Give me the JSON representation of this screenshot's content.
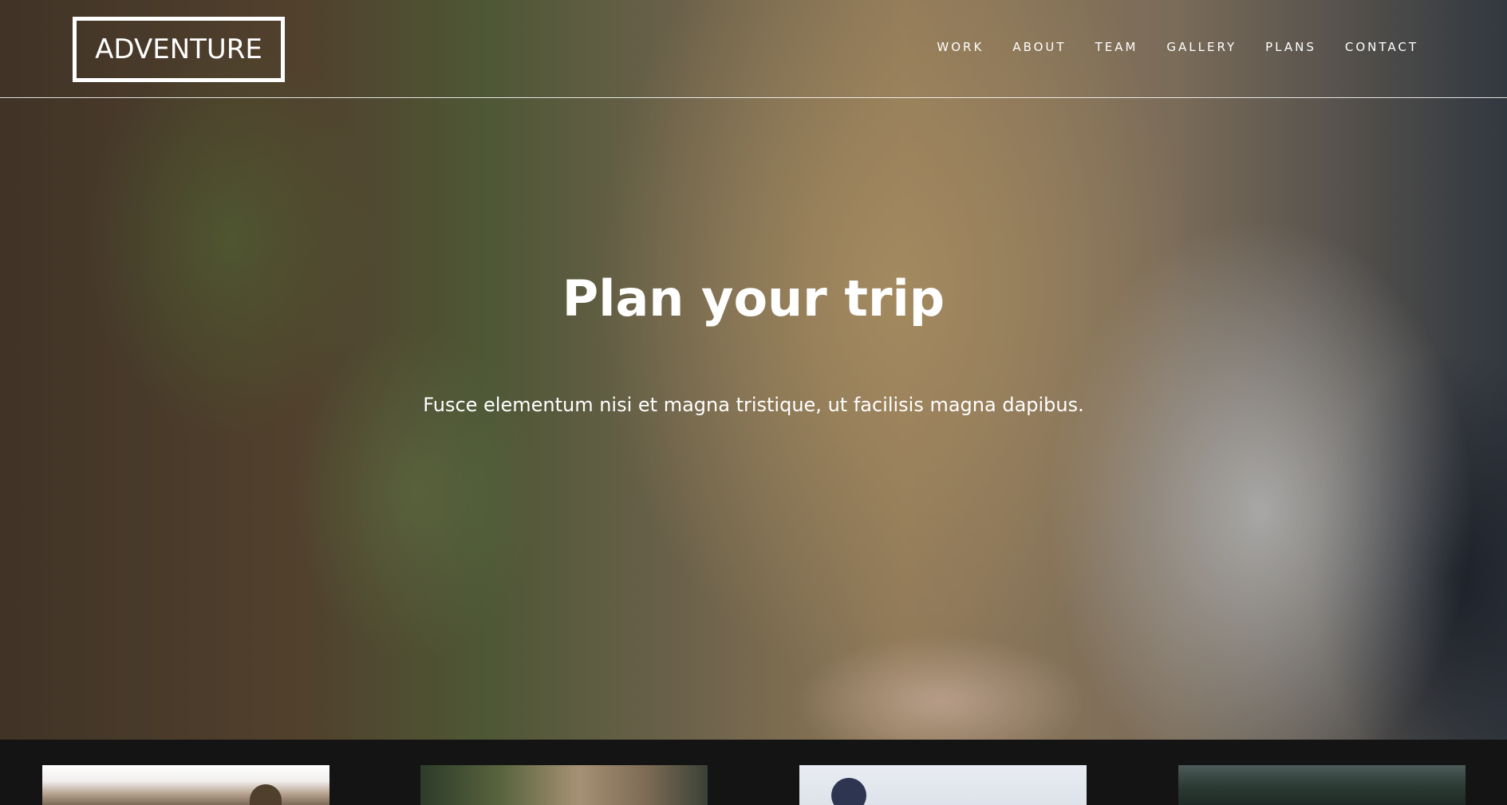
{
  "header": {
    "logo": "ADVENTURE",
    "nav": [
      "WORK",
      "ABOUT",
      "TEAM",
      "GALLERY",
      "PLANS",
      "CONTACT"
    ]
  },
  "hero": {
    "title": "Plan your trip",
    "subtitle": "Fusce elementum nisi et magna tristique, ut facilisis magna dapibus."
  },
  "colors": {
    "text": "#ffffff",
    "footer_bg": "#141414"
  }
}
